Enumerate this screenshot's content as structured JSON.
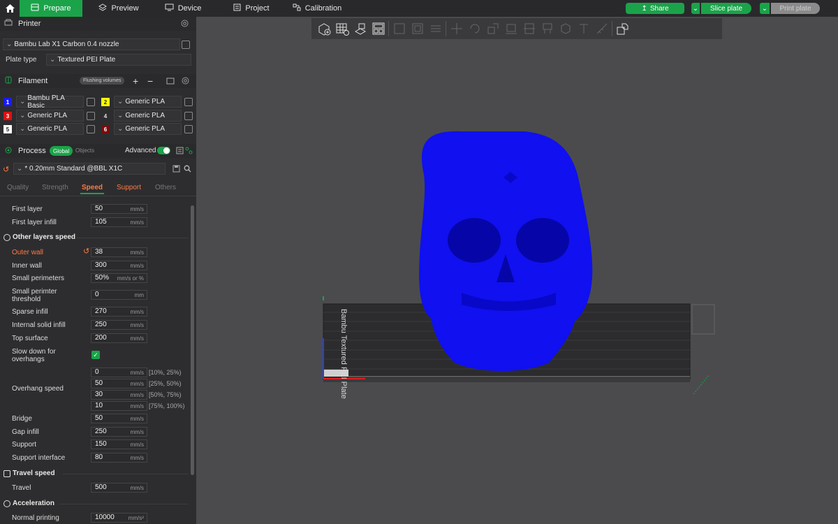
{
  "topbar": {
    "tabs": [
      {
        "label": "Prepare",
        "icon": "prepare-icon"
      },
      {
        "label": "Preview",
        "icon": "layers-icon"
      },
      {
        "label": "Device",
        "icon": "device-icon"
      },
      {
        "label": "Project",
        "icon": "project-icon"
      },
      {
        "label": "Calibration",
        "icon": "calibration-icon"
      }
    ],
    "share_label": "Share",
    "slice_label": "Slice plate",
    "print_label": "Print plate"
  },
  "printer": {
    "header": "Printer",
    "printer_name": "Bambu Lab X1 Carbon 0.4 nozzle",
    "plate_label": "Plate type",
    "plate_value": "Textured PEI Plate"
  },
  "filament": {
    "header": "Filament",
    "flushing_label": "Flushing volumes",
    "slots": [
      {
        "num": "1",
        "color": "#1a1aff",
        "text_color": "#ffffff",
        "name": "Bambu PLA Basic"
      },
      {
        "num": "2",
        "color": "#ffff00",
        "text_color": "#222222",
        "name": "Generic PLA"
      },
      {
        "num": "3",
        "color": "#e01010",
        "text_color": "#ffffff",
        "name": "Generic PLA"
      },
      {
        "num": "4",
        "color": "#2d2d2f",
        "text_color": "#e0e0e0",
        "name": "Generic PLA"
      },
      {
        "num": "5",
        "color": "#ffffff",
        "text_color": "#222222",
        "name": "Generic PLA"
      },
      {
        "num": "6",
        "color": "#7a0c0c",
        "text_color": "#ffffff",
        "name": "Generic PLA"
      }
    ]
  },
  "process": {
    "header": "Process",
    "global_label": "Global",
    "objects_label": "Objects",
    "advanced_label": "Advanced",
    "preset": "* 0.20mm Standard @BBL X1C",
    "tabs": [
      "Quality",
      "Strength",
      "Speed",
      "Support",
      "Others"
    ]
  },
  "speed": {
    "first_layer": {
      "label": "First layer",
      "value": "50",
      "unit": "mm/s"
    },
    "first_layer_infill": {
      "label": "First layer infill",
      "value": "105",
      "unit": "mm/s"
    },
    "other_header": "Other layers speed",
    "outer_wall": {
      "label": "Outer wall",
      "value": "38",
      "unit": "mm/s"
    },
    "inner_wall": {
      "label": "Inner wall",
      "value": "300",
      "unit": "mm/s"
    },
    "small_perimeters": {
      "label": "Small perimeters",
      "value": "50%",
      "unit": "mm/s or %"
    },
    "small_perimeter_threshold": {
      "label1": "Small perimter",
      "label2": "threshold",
      "value": "0",
      "unit": "mm"
    },
    "sparse_infill": {
      "label": "Sparse infill",
      "value": "270",
      "unit": "mm/s"
    },
    "internal_solid_infill": {
      "label": "Internal solid infill",
      "value": "250",
      "unit": "mm/s"
    },
    "top_surface": {
      "label": "Top surface",
      "value": "200",
      "unit": "mm/s"
    },
    "slow_down": {
      "label1": "Slow down for",
      "label2": "overhangs"
    },
    "overhang_label": "Overhang speed",
    "overhangs": [
      {
        "value": "0",
        "unit": "mm/s",
        "range": "[10%, 25%)"
      },
      {
        "value": "50",
        "unit": "mm/s",
        "range": "[25%, 50%)"
      },
      {
        "value": "30",
        "unit": "mm/s",
        "range": "[50%, 75%)"
      },
      {
        "value": "10",
        "unit": "mm/s",
        "range": "[75%, 100%)"
      }
    ],
    "bridge": {
      "label": "Bridge",
      "value": "50",
      "unit": "mm/s"
    },
    "gap_infill": {
      "label": "Gap infill",
      "value": "250",
      "unit": "mm/s"
    },
    "support": {
      "label": "Support",
      "value": "150",
      "unit": "mm/s"
    },
    "support_interface": {
      "label": "Support interface",
      "value": "80",
      "unit": "mm/s"
    },
    "travel_header": "Travel speed",
    "travel": {
      "label": "Travel",
      "value": "500",
      "unit": "mm/s"
    },
    "accel_header": "Acceleration",
    "normal_printing": {
      "label": "Normal printing",
      "value": "10000",
      "unit": "mm/s²"
    }
  },
  "viewport": {
    "plate_text": "Bambu Textured PEI Plate",
    "model_color": "#1010f0"
  },
  "colors": {
    "accent": "#1ba34a",
    "orange": "#ff7a45"
  }
}
